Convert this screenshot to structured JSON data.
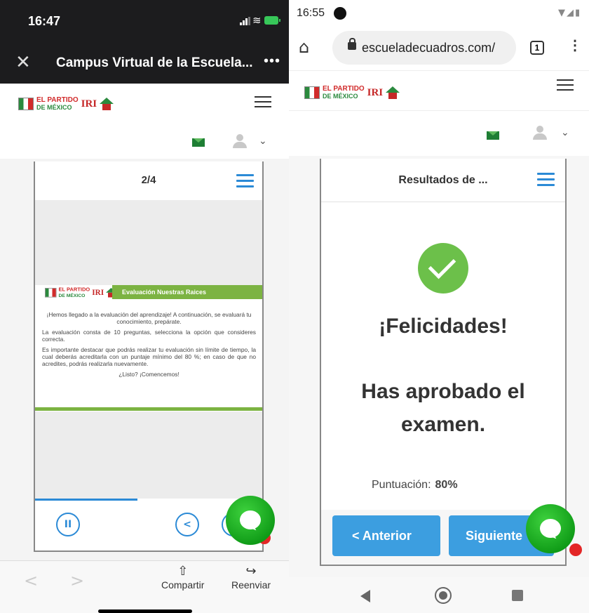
{
  "left": {
    "status": {
      "time": "16:47"
    },
    "titlebar": {
      "close": "✕",
      "title": "Campus Virtual de la Escuela...",
      "more": "•••"
    },
    "logo": {
      "line1": "EL PARTIDO",
      "line2": "DE MÉXICO",
      "iri": "IRI"
    },
    "card": {
      "page_indicator": "2/4",
      "slide": {
        "banner": "Evaluación Nuestras Raices",
        "p1": "¡Hemos llegado a la evaluación del aprendizaje! A continuación, se evaluará tu conocimiento, prepárate.",
        "p2": "La evaluación consta de 10 preguntas, selecciona la opción que consideres correcta.",
        "p3": "Es importante destacar que podrás realizar tu evaluación sin límite de tiempo, la cual deberás acreditarla con un puntaje mínimo del 80 %; en caso de que no acredites, podrás realizarla nuevamente.",
        "p4": "¿Listo? ¡Comencemos!"
      },
      "progress_percent": 45,
      "controls": {
        "pause": "II",
        "prev": "<"
      }
    },
    "bottombar": {
      "back": "<",
      "forward": ">",
      "share_label": "Compartir",
      "share_icon": "⇧",
      "forward_label": "Reenviar",
      "forward_icon": "↪"
    }
  },
  "right": {
    "status": {
      "time": "16:55",
      "icons": "▼◢▮"
    },
    "urlbar": {
      "home": "⌂",
      "url": "escueladecuadros.com/",
      "tabs_count": "1",
      "menu": "⋮"
    },
    "card": {
      "title": "Resultados de ...",
      "heading": "¡Felicidades!",
      "message": "Has aprobado el examen.",
      "score_label": "Puntuación:",
      "score_value": "80%",
      "prev_button": "< Anterior",
      "next_button": "Siguiente"
    }
  },
  "colors": {
    "accent_blue": "#2b8ad6",
    "button_blue": "#3c9ee0",
    "success_green": "#6cc04a",
    "chat_green": "#1faa1f",
    "banner_green": "#7cb342"
  }
}
